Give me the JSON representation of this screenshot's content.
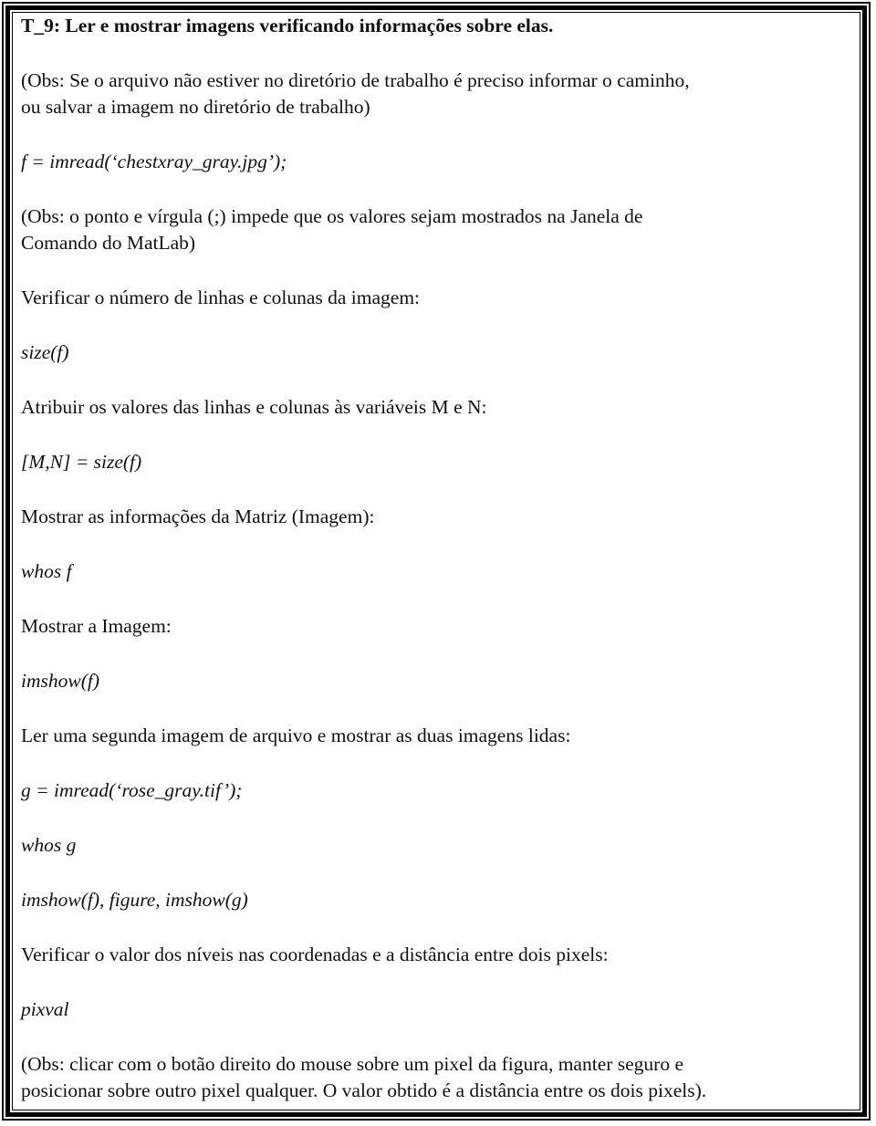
{
  "title": "T_9: Ler e mostrar  imagens verificando informações sobre elas.",
  "blocks": [
    {
      "type": "text",
      "lines": [
        "(Obs: Se o arquivo não estiver no diretório de trabalho é preciso informar o caminho,",
        "ou salvar a imagem no diretório de trabalho)"
      ]
    },
    {
      "type": "code",
      "text": "f  = imread(‘chestxray_gray.jpg’);"
    },
    {
      "type": "text",
      "lines": [
        "(Obs: o ponto e vírgula (;) impede que os valores sejam mostrados na Janela de",
        "Comando do MatLab)"
      ]
    },
    {
      "type": "text",
      "lines": [
        "Verificar o número de linhas e colunas da imagem:"
      ]
    },
    {
      "type": "code",
      "text": "size(f)"
    },
    {
      "type": "text",
      "lines": [
        "Atribuir os valores das linhas e colunas às variáveis M e N:"
      ]
    },
    {
      "type": "code",
      "text": "[M,N] = size(f)"
    },
    {
      "type": "text",
      "lines": [
        "Mostrar as informações da Matriz (Imagem):"
      ]
    },
    {
      "type": "code",
      "text": "whos  f"
    },
    {
      "type": "text",
      "lines": [
        "Mostrar a Imagem:"
      ]
    },
    {
      "type": "code",
      "text": "imshow(f)"
    },
    {
      "type": "text",
      "lines": [
        "Ler uma segunda imagem de arquivo e mostrar as duas imagens lidas:"
      ]
    },
    {
      "type": "code",
      "text": "g = imread(‘rose_gray.tif’);"
    },
    {
      "type": "code",
      "text": "whos g"
    },
    {
      "type": "code",
      "text": "imshow(f), figure, imshow(g)"
    },
    {
      "type": "text",
      "lines": [
        "Verificar o valor dos níveis nas coordenadas e a distância entre dois pixels:"
      ]
    },
    {
      "type": "code",
      "text": "pixval"
    },
    {
      "type": "text",
      "lines": [
        "(Obs: clicar com o botão direito do mouse sobre um pixel da figura, manter seguro e",
        "posicionar sobre outro pixel qualquer. O valor obtido é a distância entre os dois pixels)."
      ]
    }
  ]
}
